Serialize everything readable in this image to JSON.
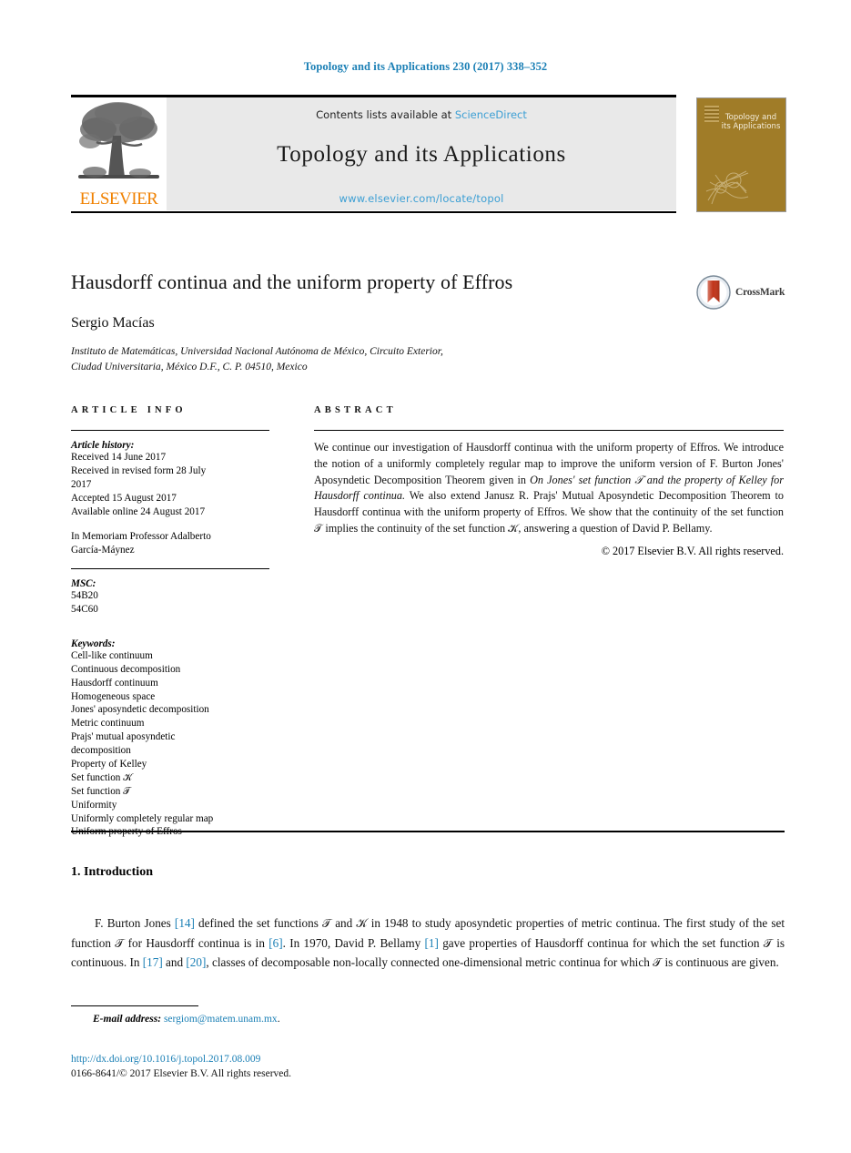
{
  "running_head": "Topology and its Applications 230 (2017) 338–352",
  "masthead": {
    "publisher_name": "ELSEVIER",
    "contents_prefix": "Contents lists available at ",
    "sciencedirect_link": "ScienceDirect",
    "journal_title": "Topology and its Applications",
    "journal_url": "www.elsevier.com/locate/topol",
    "cover_title": "Topology and its Applications",
    "link_color": "#3c9fd4",
    "band_color": "#e9e9e9",
    "cover_color": "#a07c28",
    "elsevier_orange": "#f08100"
  },
  "title_block": {
    "title": "Hausdorff continua and the uniform property of Effros",
    "author": "Sergio Macías",
    "affiliation_line1": "Instituto de Matemáticas, Universidad Nacional Autónoma de México, Circuito Exterior,",
    "affiliation_line2": "Ciudad Universitaria, México D.F., C. P. 04510, Mexico",
    "crossmark_label": "CrossMark"
  },
  "article_info": {
    "heading": "ARTICLE INFO",
    "history_label": "Article history:",
    "history_lines": [
      "Received 14 June 2017",
      "Received in revised form 28 July",
      "2017",
      "Accepted 15 August 2017",
      "Available online 24 August 2017"
    ],
    "memoriam_lines": [
      "In Memoriam Professor Adalberto",
      "García-Máynez"
    ],
    "msc_label": "MSC:",
    "msc_codes": [
      "54B20",
      "54C60"
    ],
    "keywords_label": "Keywords:",
    "keywords": [
      "Cell-like continuum",
      "Continuous decomposition",
      "Hausdorff continuum",
      "Homogeneous space",
      "Jones' aposyndetic decomposition",
      "Metric continuum",
      "Prajs' mutual aposyndetic",
      "decomposition",
      "Property of Kelley",
      "Set function 𝒦",
      "Set function 𝒯",
      "Uniformity",
      "Uniformly completely regular map",
      "Uniform property of Effros"
    ]
  },
  "abstract": {
    "heading": "ABSTRACT",
    "part1": "We continue our investigation of Hausdorff continua with the uniform property of Effros. We introduce the notion of a uniformly completely regular map to improve the uniform version of F. Burton Jones' Aposyndetic Decomposition Theorem given in ",
    "italic_ref": "On Jones' set function 𝒯 and the property of Kelley for Hausdorff continua.",
    "part2": " We also extend Janusz R. Prajs' Mutual Aposyndetic Decomposition Theorem to Hausdorff continua with the uniform property of Effros. We show that the continuity of the set function 𝒯 implies the continuity of the set function 𝒦, answering a question of David P. Bellamy.",
    "copyright": "© 2017 Elsevier B.V. All rights reserved."
  },
  "introduction": {
    "heading": "1. Introduction",
    "p1_a": "F. Burton Jones ",
    "ref14": "[14]",
    "p1_b": " defined the set functions 𝒯 and 𝒦 in 1948 to study aposyndetic properties of metric continua. The first study of the set function 𝒯 for Hausdorff continua is in ",
    "ref6": "[6]",
    "p1_c": ". In 1970, David P. Bellamy ",
    "ref1": "[1]",
    "p1_d": " gave properties of Hausdorff continua for which the set function 𝒯 is continuous. In ",
    "ref17": "[17]",
    "p1_e": " and ",
    "ref20": "[20]",
    "p1_f": ", classes of decomposable non-locally connected one-dimensional metric continua for which 𝒯 is continuous are given."
  },
  "footer": {
    "email_label": "E-mail address:",
    "email": "sergiom@matem.unam.mx",
    "email_period": ".",
    "doi": "http://dx.doi.org/10.1016/j.topol.2017.08.009",
    "issn_line": "0166-8641/© 2017 Elsevier B.V. All rights reserved.",
    "link_color": "#1a7fb5"
  }
}
